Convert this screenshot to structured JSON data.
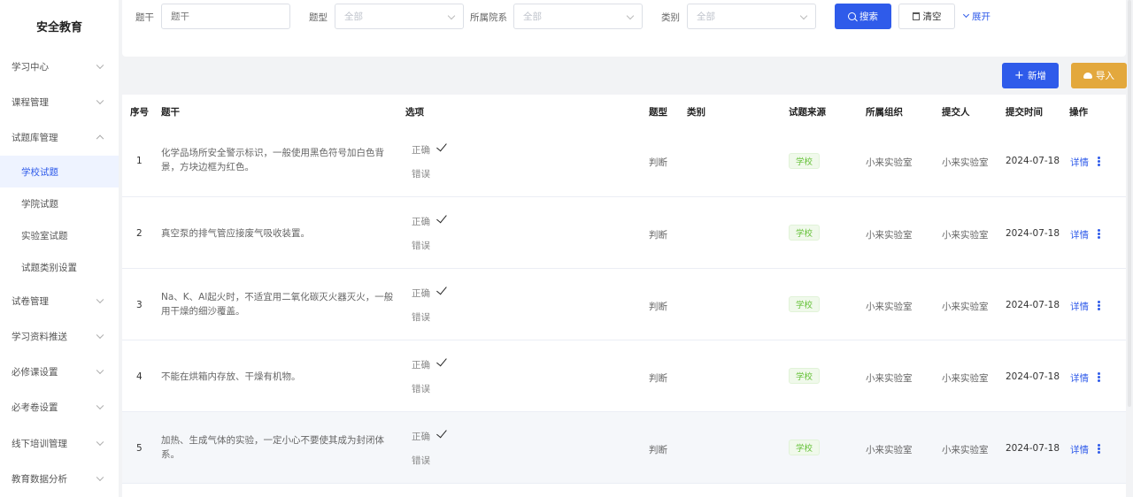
{
  "sidebar": {
    "brand": "安全教育",
    "items": [
      {
        "label": "学习中心"
      },
      {
        "label": "课程管理"
      },
      {
        "label": "试题库管理"
      },
      {
        "label": "学校试题"
      },
      {
        "label": "学院试题"
      },
      {
        "label": "实验室试题"
      },
      {
        "label": "试题类别设置"
      },
      {
        "label": "试卷管理"
      },
      {
        "label": "学习资料推送"
      },
      {
        "label": "必修课设置"
      },
      {
        "label": "必考卷设置"
      },
      {
        "label": "线下培训管理"
      },
      {
        "label": "教育数据分析"
      }
    ]
  },
  "filters": {
    "stem_label": "题干",
    "stem_placeholder": "题干",
    "type_label": "题型",
    "type_value": "全部",
    "college_label": "所属院系",
    "college_value": "全部",
    "category_label": "类别",
    "category_value": "全部",
    "search_label": "搜索",
    "clear_label": "清空",
    "expand_label": "展开"
  },
  "actions": {
    "add_label": "新增",
    "import_label": "导入"
  },
  "table": {
    "headers": [
      "序号",
      "题干",
      "选项",
      "题型",
      "类别",
      "试题来源",
      "所属组织",
      "提交人",
      "提交时间",
      "操作"
    ],
    "rows": [
      {
        "seq": "1",
        "stem": "化学品场所安全警示标识，一般使用黑色符号加白色背景，方块边框为红色。",
        "opt1": "正确",
        "opt2": "错误",
        "type": "判断",
        "source": "学校",
        "org": "小来实验室",
        "submitter": "小来实验室",
        "date": "2024-07-18",
        "action": "详情"
      },
      {
        "seq": "2",
        "stem": "真空泵的排气管应接废气吸收装置。",
        "opt1": "正确",
        "opt2": "错误",
        "type": "判断",
        "source": "学校",
        "org": "小来实验室",
        "submitter": "小来实验室",
        "date": "2024-07-18",
        "action": "详情"
      },
      {
        "seq": "3",
        "stem": "Na、K、Al起火时，不适宜用二氧化碳灭火器灭火，一般用干燥的细沙覆盖。",
        "opt1": "正确",
        "opt2": "错误",
        "type": "判断",
        "source": "学校",
        "org": "小来实验室",
        "submitter": "小来实验室",
        "date": "2024-07-18",
        "action": "详情"
      },
      {
        "seq": "4",
        "stem": "不能在烘箱内存放、干燥有机物。",
        "opt1": "正确",
        "opt2": "错误",
        "type": "判断",
        "source": "学校",
        "org": "小来实验室",
        "submitter": "小来实验室",
        "date": "2024-07-18",
        "action": "详情"
      },
      {
        "seq": "5",
        "stem": "加热、生成气体的实验，一定小心不要使其成为封闭体系。",
        "opt1": "正确",
        "opt2": "错误",
        "type": "判断",
        "source": "学校",
        "org": "小来实验室",
        "submitter": "小来实验室",
        "date": "2024-07-18",
        "action": "详情"
      }
    ]
  },
  "colors": {
    "primary": "#2f5bea",
    "warning": "#e3a83d",
    "tag_green": "#67c23a"
  }
}
